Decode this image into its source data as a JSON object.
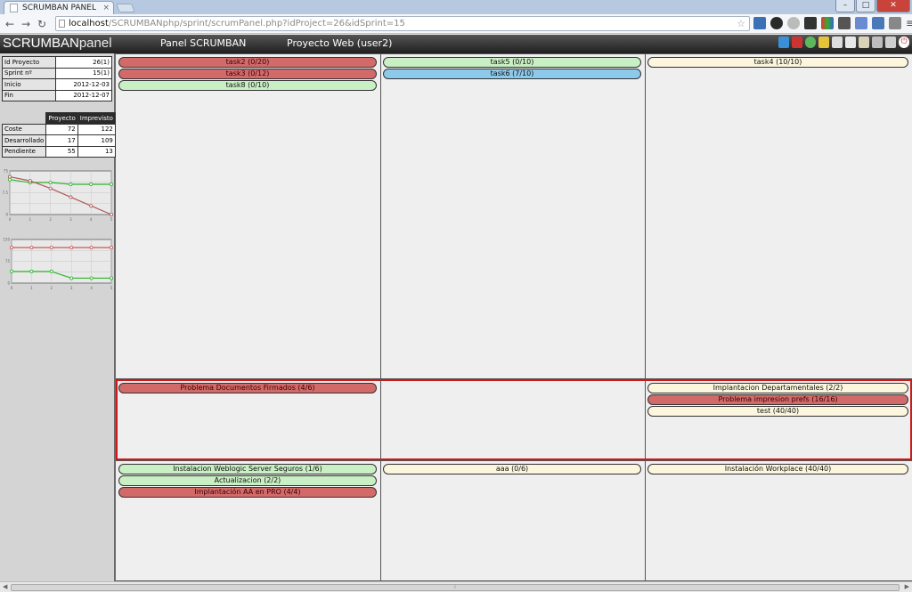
{
  "browser": {
    "tab_title": "SCRUMBAN PANEL",
    "url_host": "localhost",
    "url_path": "/SCRUMBANphp/sprint/scrumPanel.php?idProject=26&idSprint=15"
  },
  "header": {
    "logo_scrumban": "SCRUMBAN",
    "logo_panel": "panel",
    "title": "Panel SCRUMBAN",
    "project": "Proyecto Web (user2)"
  },
  "sidebar": {
    "info": [
      {
        "label": "Id Proyecto",
        "value": "26(1)"
      },
      {
        "label": "Sprint nº",
        "value": "15(1)"
      },
      {
        "label": "Inicio",
        "value": "2012-12-03"
      },
      {
        "label": "Fin",
        "value": "2012-12-07"
      }
    ],
    "costs": {
      "headers": [
        "Proyecto",
        "Imprevisto"
      ],
      "rows": [
        {
          "label": "Coste",
          "proyecto": "72",
          "imprevisto": "122"
        },
        {
          "label": "Desarrollado",
          "proyecto": "17",
          "imprevisto": "109"
        },
        {
          "label": "Pendiente",
          "proyecto": "55",
          "imprevisto": "13"
        }
      ]
    }
  },
  "chart_data": [
    {
      "type": "line",
      "x": [
        0,
        1,
        2,
        3,
        4,
        5
      ],
      "ylim": [
        0,
        75
      ],
      "grid": true,
      "series": [
        {
          "color": "#2bb52b",
          "values": [
            60,
            55,
            55,
            52,
            52,
            52
          ]
        },
        {
          "color": "#b05858",
          "values": [
            65,
            58,
            45,
            30,
            15,
            0
          ]
        }
      ]
    },
    {
      "type": "line",
      "x": [
        0,
        1,
        2,
        3,
        4,
        5
      ],
      "ylim": [
        0,
        150
      ],
      "grid": true,
      "series": [
        {
          "color": "#c45a5a",
          "values": [
            122,
            122,
            122,
            122,
            122,
            122
          ]
        },
        {
          "color": "#2bb52b",
          "values": [
            40,
            40,
            40,
            17,
            17,
            17
          ]
        }
      ]
    }
  ],
  "board": {
    "colors": {
      "red": "#d26a6a",
      "green": "#c9efc4",
      "blue": "#8cc9ea",
      "yellow": "#fbf6dd",
      "blocked_border": "#cc1a1a"
    },
    "rows": [
      {
        "columns": [
          [
            "task2 (0/20)",
            "task3 (0/12)",
            "task8 (0/10)"
          ],
          [
            "task5 (0/10)",
            "task6 (7/10)"
          ],
          [
            "task4 (10/10)"
          ]
        ]
      },
      {
        "columns": [
          [
            "Problema Documentos Firmados (4/6)"
          ],
          [],
          [
            "Implantacion Departamentales (2/2)",
            "Problema impresion prefs (16/16)",
            "test (40/40)"
          ]
        ]
      },
      {
        "columns": [
          [
            "Instalacion Weblogic Server Seguros (1/6)",
            "Actualizacion  (2/2)",
            "Implantación AA en PRO (4/4)"
          ],
          [
            "aaa (0/6)"
          ],
          [
            "Instalación Workplace (40/40)"
          ]
        ]
      }
    ]
  }
}
